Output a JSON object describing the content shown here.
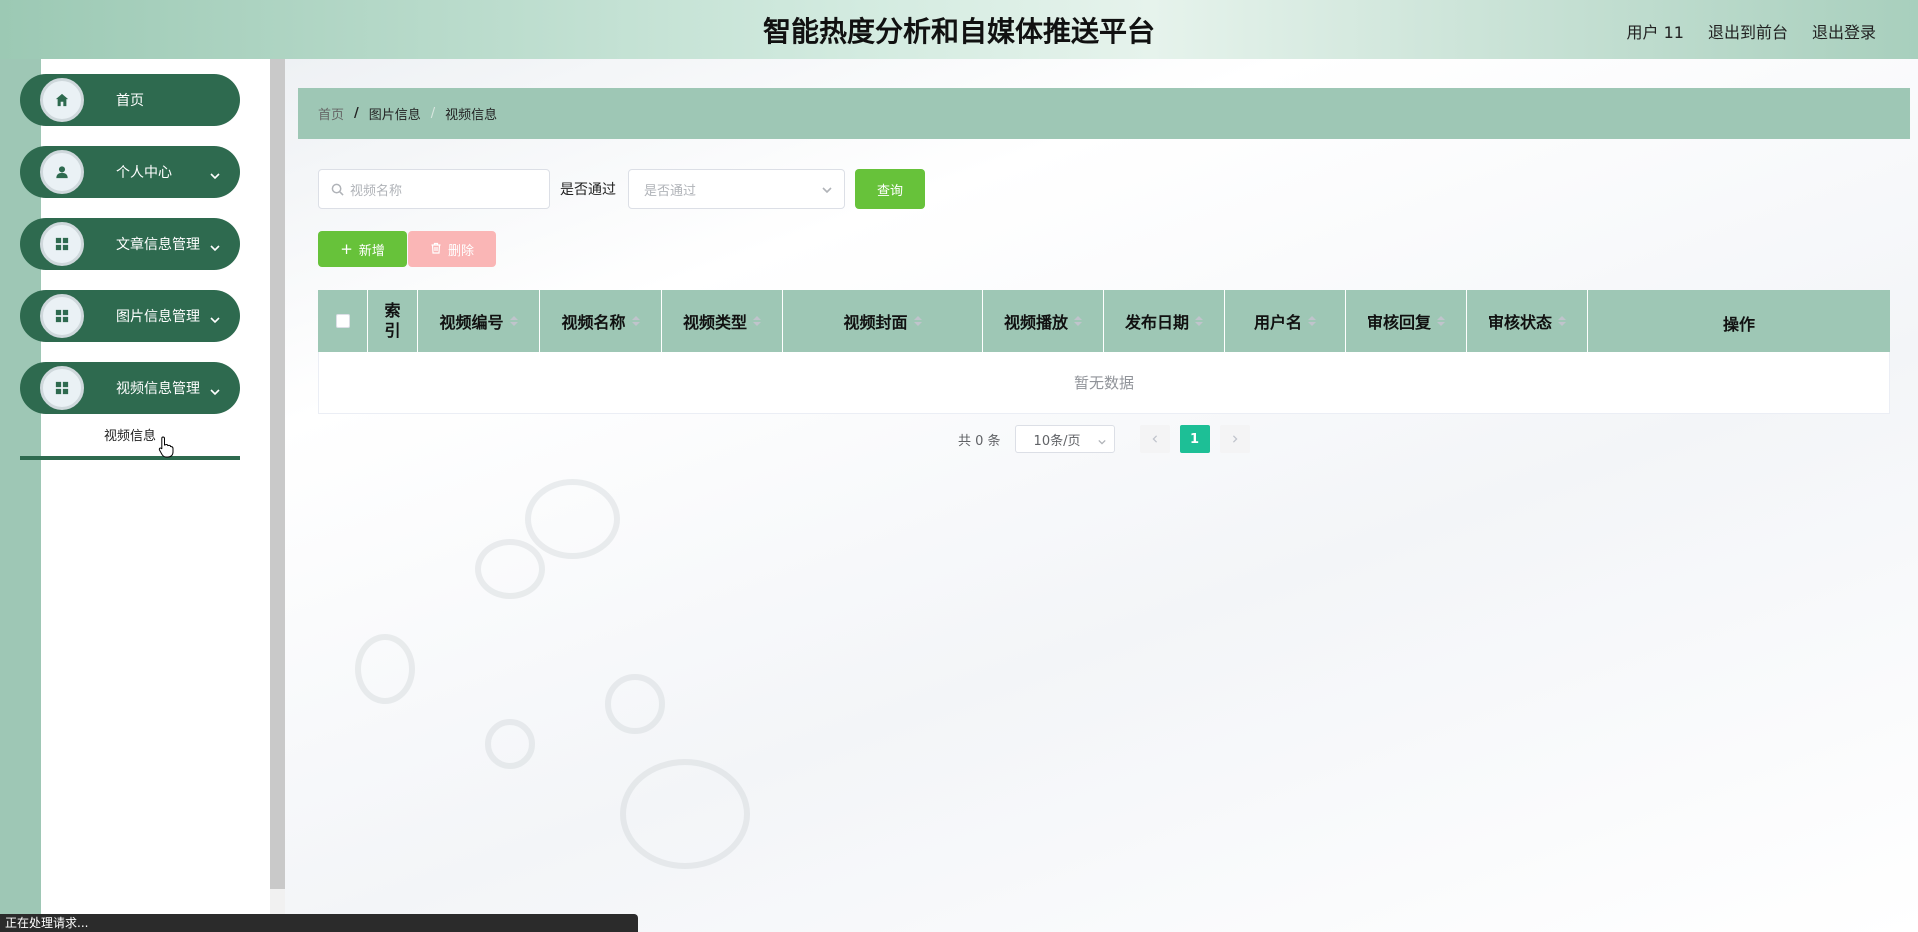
{
  "header": {
    "title": "智能热度分析和自媒体推送平台",
    "user": "用户 11",
    "back_to_front": "退出到前台",
    "logout": "退出登录"
  },
  "sidebar": {
    "items": [
      {
        "label": "首页",
        "icon": "home-icon"
      },
      {
        "label": "个人中心",
        "icon": "user-icon"
      },
      {
        "label": "文章信息管理",
        "icon": "grid-icon"
      },
      {
        "label": "图片信息管理",
        "icon": "grid-icon"
      },
      {
        "label": "视频信息管理",
        "icon": "grid-icon"
      }
    ],
    "active_subitem": "视频信息"
  },
  "breadcrumb": {
    "home": "首页",
    "middle": "图片信息",
    "current": "视频信息"
  },
  "search": {
    "name_placeholder": "视频名称",
    "filter_label": "是否通过",
    "filter_placeholder": "是否通过",
    "query_label": "查询"
  },
  "actions": {
    "add_label": "新增",
    "delete_label": "删除"
  },
  "table": {
    "columns": [
      "索引",
      "视频编号",
      "视频名称",
      "视频类型",
      "视频封面",
      "视频播放",
      "发布日期",
      "用户名",
      "审核回复",
      "审核状态",
      "操作"
    ],
    "empty_text": "暂无数据"
  },
  "pagination": {
    "total": "共 0 条",
    "page_size": "10条/页",
    "current_page": "1"
  },
  "status_bar": "正在处理请求..."
}
